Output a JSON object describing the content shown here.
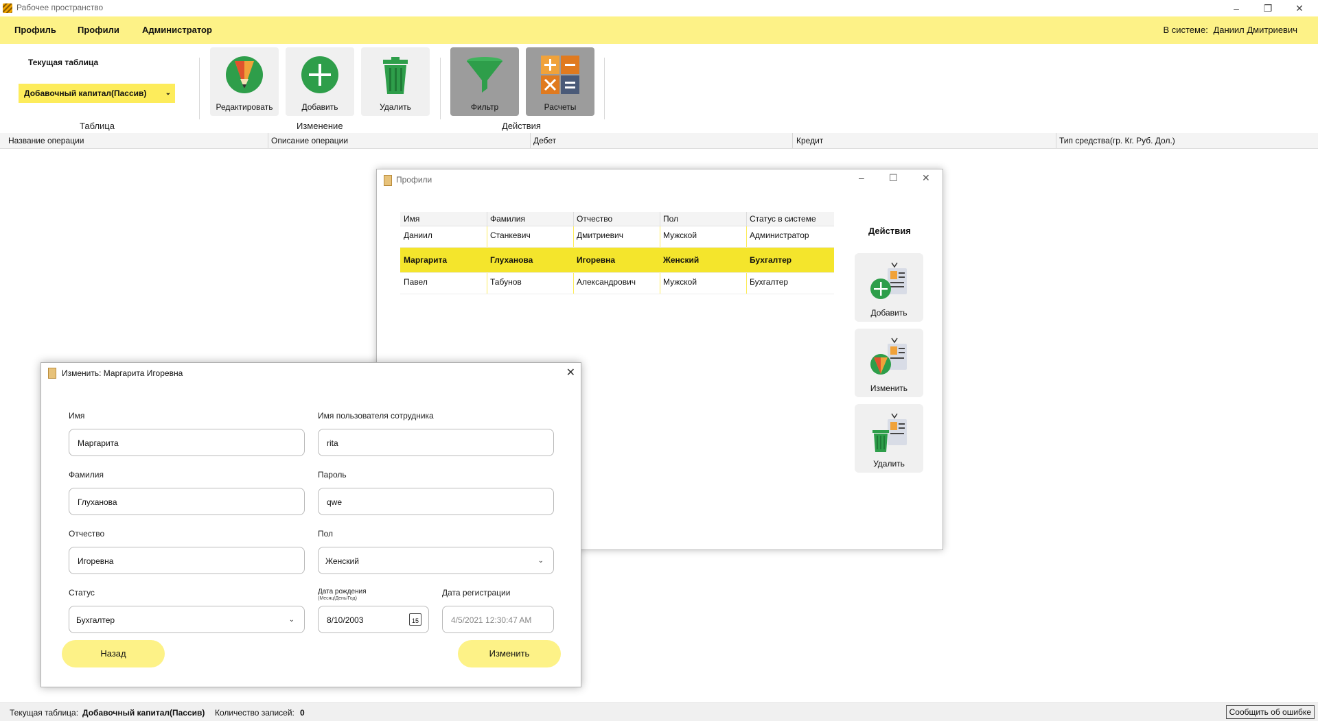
{
  "window": {
    "title": "Рабочее пространство"
  },
  "menu": {
    "items": [
      "Профиль",
      "Профили",
      "Администратор"
    ],
    "login_prefix": "В системе:",
    "login_user": "Даниил Дмитриевич"
  },
  "ribbon": {
    "current_table_label": "Текущая таблица",
    "current_table_value": "Добавочный капитал(Пассив)",
    "buttons": {
      "edit": "Редактировать",
      "add": "Добавить",
      "delete": "Удалить",
      "filter": "Фильтр",
      "calc": "Расчеты"
    },
    "groups": {
      "table": "Таблица",
      "change": "Изменение",
      "actions": "Действия"
    }
  },
  "grid": {
    "columns": [
      "Название операции",
      "Описание операции",
      "Дебет",
      "Кредит",
      "Тип средства(гр. Кг. Руб. Дол.)"
    ]
  },
  "profiles_window": {
    "title": "Профили",
    "columns": [
      "Имя",
      "Фамилия",
      "Отчество",
      "Пол",
      "Статус в системе"
    ],
    "rows": [
      [
        "Даниил",
        "Станкевич",
        "Дмитриевич",
        "Мужской",
        "Администратор"
      ],
      [
        "Маргарита",
        "Глуханова",
        "Игоревна",
        "Женский",
        "Бухгалтер"
      ],
      [
        "Павел",
        "Табунов",
        "Александрович",
        "Мужской",
        "Бухгалтер"
      ]
    ],
    "selected_row": 1,
    "actions_title": "Действия",
    "actions": {
      "add": "Добавить",
      "edit": "Изменить",
      "delete": "Удалить"
    }
  },
  "edit_dialog": {
    "title": "Изменить: Маргарита Игоревна",
    "labels": {
      "first_name": "Имя",
      "username": "Имя пользователя сотрудника",
      "last_name": "Фамилия",
      "password": "Пароль",
      "patronymic": "Отчество",
      "gender": "Пол",
      "status": "Статус",
      "birth_date": "Дата рождения",
      "birth_date_hint": "(Месяц/День/Год)",
      "reg_date": "Дата регистрации"
    },
    "values": {
      "first_name": "Маргарита",
      "username": "rita",
      "last_name": "Глуханова",
      "password": "qwe",
      "patronymic": "Игоревна",
      "gender": "Женский",
      "status": "Бухгалтер",
      "birth_date": "8/10/2003",
      "calendar_day": "15",
      "reg_date": "4/5/2021 12:30:47 AM"
    },
    "buttons": {
      "back": "Назад",
      "save": "Изменить"
    }
  },
  "statusbar": {
    "table_label": "Текущая таблица:",
    "table_value": "Добавочный капитал(Пассив)",
    "count_label": "Количество записей:",
    "count_value": "0",
    "report": "Сообщить об ошибке"
  },
  "colors": {
    "menu_bg": "#fdf287",
    "accent_yellow": "#f4e52c",
    "select_bg": "#fdec5b"
  }
}
